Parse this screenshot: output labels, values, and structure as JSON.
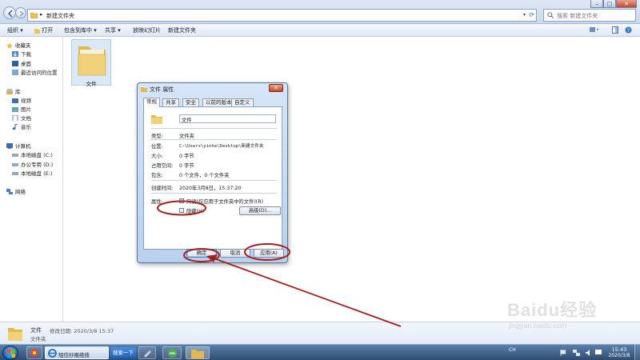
{
  "window": {
    "path": "新建文件夹",
    "search_placeholder": "搜索 新建文件夹"
  },
  "toolbar": {
    "items": [
      "组织 ▾",
      "打开",
      "包含到库中 ▾",
      "共享 ▾",
      "放映幻灯片",
      "新建文件夹"
    ]
  },
  "sidebar": {
    "favorites": "收藏夹",
    "fav_items": [
      "下载",
      "桌面",
      "最近访问的位置"
    ],
    "library": "库",
    "lib_items": [
      "视频",
      "图片",
      "文档",
      "音乐"
    ],
    "computer": "计算机",
    "comp_items": [
      "本地磁盘 (C:)",
      "办公专用 (D:)",
      "本地磁盘 (E:)"
    ],
    "network": "网络"
  },
  "content": {
    "folder_name": "文件"
  },
  "dialog": {
    "title": "文件 属性",
    "tabs": [
      "常规",
      "共享",
      "安全",
      "以前的版本",
      "自定义"
    ],
    "name_value": "文件",
    "rows": [
      {
        "label": "类型:",
        "value": "文件夹"
      },
      {
        "label": "位置:",
        "value": "C:\\Users\\yinhe\\Desktop\\新建文件夹"
      },
      {
        "label": "大小:",
        "value": "0 字节"
      },
      {
        "label": "占用空间:",
        "value": "0 字节"
      },
      {
        "label": "包含:",
        "value": "0 个文件，0 个文件夹"
      }
    ],
    "created_label": "创建时间:",
    "created_value": "2020年3月8日，15:37:20",
    "attributes_label": "属性:",
    "readonly_label": "只读(仅应用于文件夹中的文件)(R)",
    "hidden_label": "隐藏(H)",
    "advanced_button": "高级(D)...",
    "ok_button": "确定",
    "cancel_button": "取消",
    "apply_button": "应用(A)"
  },
  "details": {
    "name": "文件",
    "modified": "修改日期: 2020/3/8 15:37",
    "type": "文件夹"
  },
  "taskbar": {
    "ie_label": "短信抄报绝技",
    "search_button": "搜索一下",
    "tray": "CH",
    "time": "15:43",
    "date": "2020/3/8"
  },
  "watermark": {
    "brand": "Baidu经验",
    "sub": "jingyan.baidu.com"
  },
  "colors": {
    "annotation": "#a32020",
    "explorer_bg": "#ffffff",
    "chrome": "#c9d9ee"
  }
}
